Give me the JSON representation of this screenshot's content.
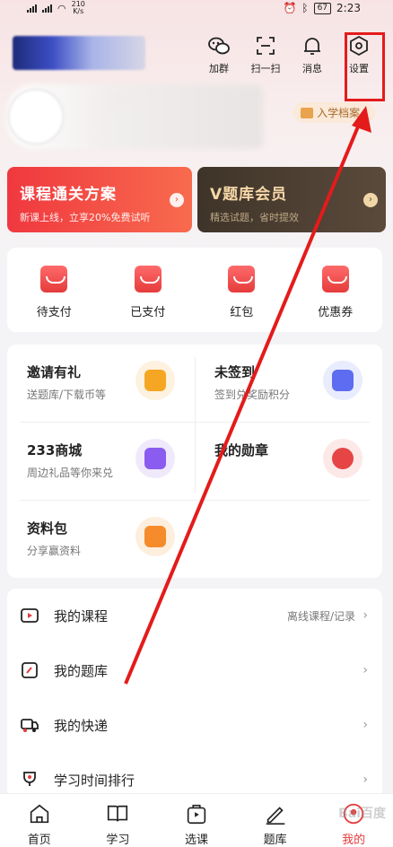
{
  "status_bar": {
    "net_speed_value": "210",
    "net_speed_unit": "K/s",
    "battery": "67",
    "time": "2:23"
  },
  "header": {
    "actions": [
      {
        "label": "加群",
        "icon": "wechat-group-icon"
      },
      {
        "label": "扫一扫",
        "icon": "scan-icon"
      },
      {
        "label": "消息",
        "icon": "bell-icon"
      },
      {
        "label": "设置",
        "icon": "settings-icon"
      }
    ],
    "archive_label": "入学档案"
  },
  "promos": [
    {
      "title": "课程通关方案",
      "subtitle": "新课上线，立享20%免费试听"
    },
    {
      "title": "V题库会员",
      "subtitle": "精选试题，省时提效"
    }
  ],
  "orders": [
    {
      "label": "待支付",
      "icon": "pending-payment-icon"
    },
    {
      "label": "已支付",
      "icon": "paid-wallet-icon"
    },
    {
      "label": "红包",
      "icon": "red-envelope-icon"
    },
    {
      "label": "优惠券",
      "icon": "coupon-icon"
    }
  ],
  "features": [
    {
      "title": "邀请有礼",
      "subtitle": "送题库/下载币等",
      "icon": "gift-icon"
    },
    {
      "title": "未签到",
      "subtitle": "签到兑奖励积分",
      "icon": "calendar-icon"
    },
    {
      "title": "233商城",
      "subtitle": "周边礼品等你来兑",
      "icon": "shop-icon"
    },
    {
      "title": "我的勋章",
      "subtitle": "",
      "icon": "medal-icon"
    },
    {
      "title": "资料包",
      "subtitle": "分享赢资料",
      "icon": "pdf-folder-icon"
    }
  ],
  "list": [
    {
      "label": "我的课程",
      "extra": "离线课程/记录",
      "icon": "video-icon"
    },
    {
      "label": "我的题库",
      "extra": "",
      "icon": "edit-icon"
    },
    {
      "label": "我的快递",
      "extra": "",
      "icon": "truck-icon"
    },
    {
      "label": "学习时间排行",
      "extra": "",
      "icon": "trophy-icon"
    }
  ],
  "nav": [
    {
      "label": "首页",
      "icon": "home-icon"
    },
    {
      "label": "学习",
      "icon": "book-icon"
    },
    {
      "label": "选课",
      "icon": "course-bag-icon"
    },
    {
      "label": "题库",
      "icon": "pen-icon"
    },
    {
      "label": "我的",
      "icon": "profile-icon",
      "active": true
    }
  ],
  "watermark": "Bai百度",
  "colors": {
    "accent": "#e63b3b",
    "annotation": "#e41b1b"
  }
}
